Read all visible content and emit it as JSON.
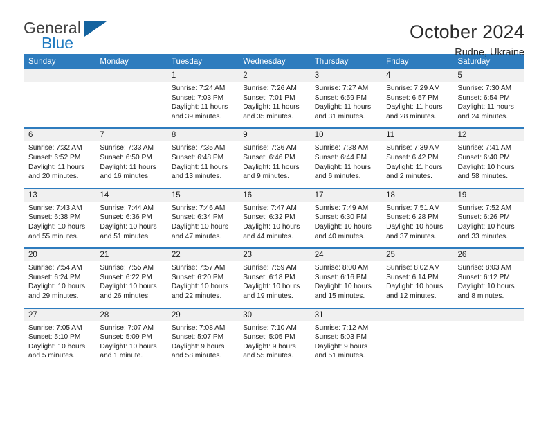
{
  "brand": {
    "name_part1": "General",
    "name_part2": "Blue",
    "accent_color": "#1f7ac0",
    "triangle_color": "#14639f"
  },
  "header": {
    "month_title": "October 2024",
    "location": "Rudne, Ukraine",
    "header_bg": "#2e7cbe",
    "daynum_bg": "#f0f0f0"
  },
  "weekdays": [
    "Sunday",
    "Monday",
    "Tuesday",
    "Wednesday",
    "Thursday",
    "Friday",
    "Saturday"
  ],
  "weeks": [
    [
      {
        "day": "",
        "sunrise": "",
        "sunset": "",
        "daylight": ""
      },
      {
        "day": "",
        "sunrise": "",
        "sunset": "",
        "daylight": ""
      },
      {
        "day": "1",
        "sunrise": "Sunrise: 7:24 AM",
        "sunset": "Sunset: 7:03 PM",
        "daylight": "Daylight: 11 hours and 39 minutes."
      },
      {
        "day": "2",
        "sunrise": "Sunrise: 7:26 AM",
        "sunset": "Sunset: 7:01 PM",
        "daylight": "Daylight: 11 hours and 35 minutes."
      },
      {
        "day": "3",
        "sunrise": "Sunrise: 7:27 AM",
        "sunset": "Sunset: 6:59 PM",
        "daylight": "Daylight: 11 hours and 31 minutes."
      },
      {
        "day": "4",
        "sunrise": "Sunrise: 7:29 AM",
        "sunset": "Sunset: 6:57 PM",
        "daylight": "Daylight: 11 hours and 28 minutes."
      },
      {
        "day": "5",
        "sunrise": "Sunrise: 7:30 AM",
        "sunset": "Sunset: 6:54 PM",
        "daylight": "Daylight: 11 hours and 24 minutes."
      }
    ],
    [
      {
        "day": "6",
        "sunrise": "Sunrise: 7:32 AM",
        "sunset": "Sunset: 6:52 PM",
        "daylight": "Daylight: 11 hours and 20 minutes."
      },
      {
        "day": "7",
        "sunrise": "Sunrise: 7:33 AM",
        "sunset": "Sunset: 6:50 PM",
        "daylight": "Daylight: 11 hours and 16 minutes."
      },
      {
        "day": "8",
        "sunrise": "Sunrise: 7:35 AM",
        "sunset": "Sunset: 6:48 PM",
        "daylight": "Daylight: 11 hours and 13 minutes."
      },
      {
        "day": "9",
        "sunrise": "Sunrise: 7:36 AM",
        "sunset": "Sunset: 6:46 PM",
        "daylight": "Daylight: 11 hours and 9 minutes."
      },
      {
        "day": "10",
        "sunrise": "Sunrise: 7:38 AM",
        "sunset": "Sunset: 6:44 PM",
        "daylight": "Daylight: 11 hours and 6 minutes."
      },
      {
        "day": "11",
        "sunrise": "Sunrise: 7:39 AM",
        "sunset": "Sunset: 6:42 PM",
        "daylight": "Daylight: 11 hours and 2 minutes."
      },
      {
        "day": "12",
        "sunrise": "Sunrise: 7:41 AM",
        "sunset": "Sunset: 6:40 PM",
        "daylight": "Daylight: 10 hours and 58 minutes."
      }
    ],
    [
      {
        "day": "13",
        "sunrise": "Sunrise: 7:43 AM",
        "sunset": "Sunset: 6:38 PM",
        "daylight": "Daylight: 10 hours and 55 minutes."
      },
      {
        "day": "14",
        "sunrise": "Sunrise: 7:44 AM",
        "sunset": "Sunset: 6:36 PM",
        "daylight": "Daylight: 10 hours and 51 minutes."
      },
      {
        "day": "15",
        "sunrise": "Sunrise: 7:46 AM",
        "sunset": "Sunset: 6:34 PM",
        "daylight": "Daylight: 10 hours and 47 minutes."
      },
      {
        "day": "16",
        "sunrise": "Sunrise: 7:47 AM",
        "sunset": "Sunset: 6:32 PM",
        "daylight": "Daylight: 10 hours and 44 minutes."
      },
      {
        "day": "17",
        "sunrise": "Sunrise: 7:49 AM",
        "sunset": "Sunset: 6:30 PM",
        "daylight": "Daylight: 10 hours and 40 minutes."
      },
      {
        "day": "18",
        "sunrise": "Sunrise: 7:51 AM",
        "sunset": "Sunset: 6:28 PM",
        "daylight": "Daylight: 10 hours and 37 minutes."
      },
      {
        "day": "19",
        "sunrise": "Sunrise: 7:52 AM",
        "sunset": "Sunset: 6:26 PM",
        "daylight": "Daylight: 10 hours and 33 minutes."
      }
    ],
    [
      {
        "day": "20",
        "sunrise": "Sunrise: 7:54 AM",
        "sunset": "Sunset: 6:24 PM",
        "daylight": "Daylight: 10 hours and 29 minutes."
      },
      {
        "day": "21",
        "sunrise": "Sunrise: 7:55 AM",
        "sunset": "Sunset: 6:22 PM",
        "daylight": "Daylight: 10 hours and 26 minutes."
      },
      {
        "day": "22",
        "sunrise": "Sunrise: 7:57 AM",
        "sunset": "Sunset: 6:20 PM",
        "daylight": "Daylight: 10 hours and 22 minutes."
      },
      {
        "day": "23",
        "sunrise": "Sunrise: 7:59 AM",
        "sunset": "Sunset: 6:18 PM",
        "daylight": "Daylight: 10 hours and 19 minutes."
      },
      {
        "day": "24",
        "sunrise": "Sunrise: 8:00 AM",
        "sunset": "Sunset: 6:16 PM",
        "daylight": "Daylight: 10 hours and 15 minutes."
      },
      {
        "day": "25",
        "sunrise": "Sunrise: 8:02 AM",
        "sunset": "Sunset: 6:14 PM",
        "daylight": "Daylight: 10 hours and 12 minutes."
      },
      {
        "day": "26",
        "sunrise": "Sunrise: 8:03 AM",
        "sunset": "Sunset: 6:12 PM",
        "daylight": "Daylight: 10 hours and 8 minutes."
      }
    ],
    [
      {
        "day": "27",
        "sunrise": "Sunrise: 7:05 AM",
        "sunset": "Sunset: 5:10 PM",
        "daylight": "Daylight: 10 hours and 5 minutes."
      },
      {
        "day": "28",
        "sunrise": "Sunrise: 7:07 AM",
        "sunset": "Sunset: 5:09 PM",
        "daylight": "Daylight: 10 hours and 1 minute."
      },
      {
        "day": "29",
        "sunrise": "Sunrise: 7:08 AM",
        "sunset": "Sunset: 5:07 PM",
        "daylight": "Daylight: 9 hours and 58 minutes."
      },
      {
        "day": "30",
        "sunrise": "Sunrise: 7:10 AM",
        "sunset": "Sunset: 5:05 PM",
        "daylight": "Daylight: 9 hours and 55 minutes."
      },
      {
        "day": "31",
        "sunrise": "Sunrise: 7:12 AM",
        "sunset": "Sunset: 5:03 PM",
        "daylight": "Daylight: 9 hours and 51 minutes."
      },
      {
        "day": "",
        "sunrise": "",
        "sunset": "",
        "daylight": ""
      },
      {
        "day": "",
        "sunrise": "",
        "sunset": "",
        "daylight": ""
      }
    ]
  ]
}
